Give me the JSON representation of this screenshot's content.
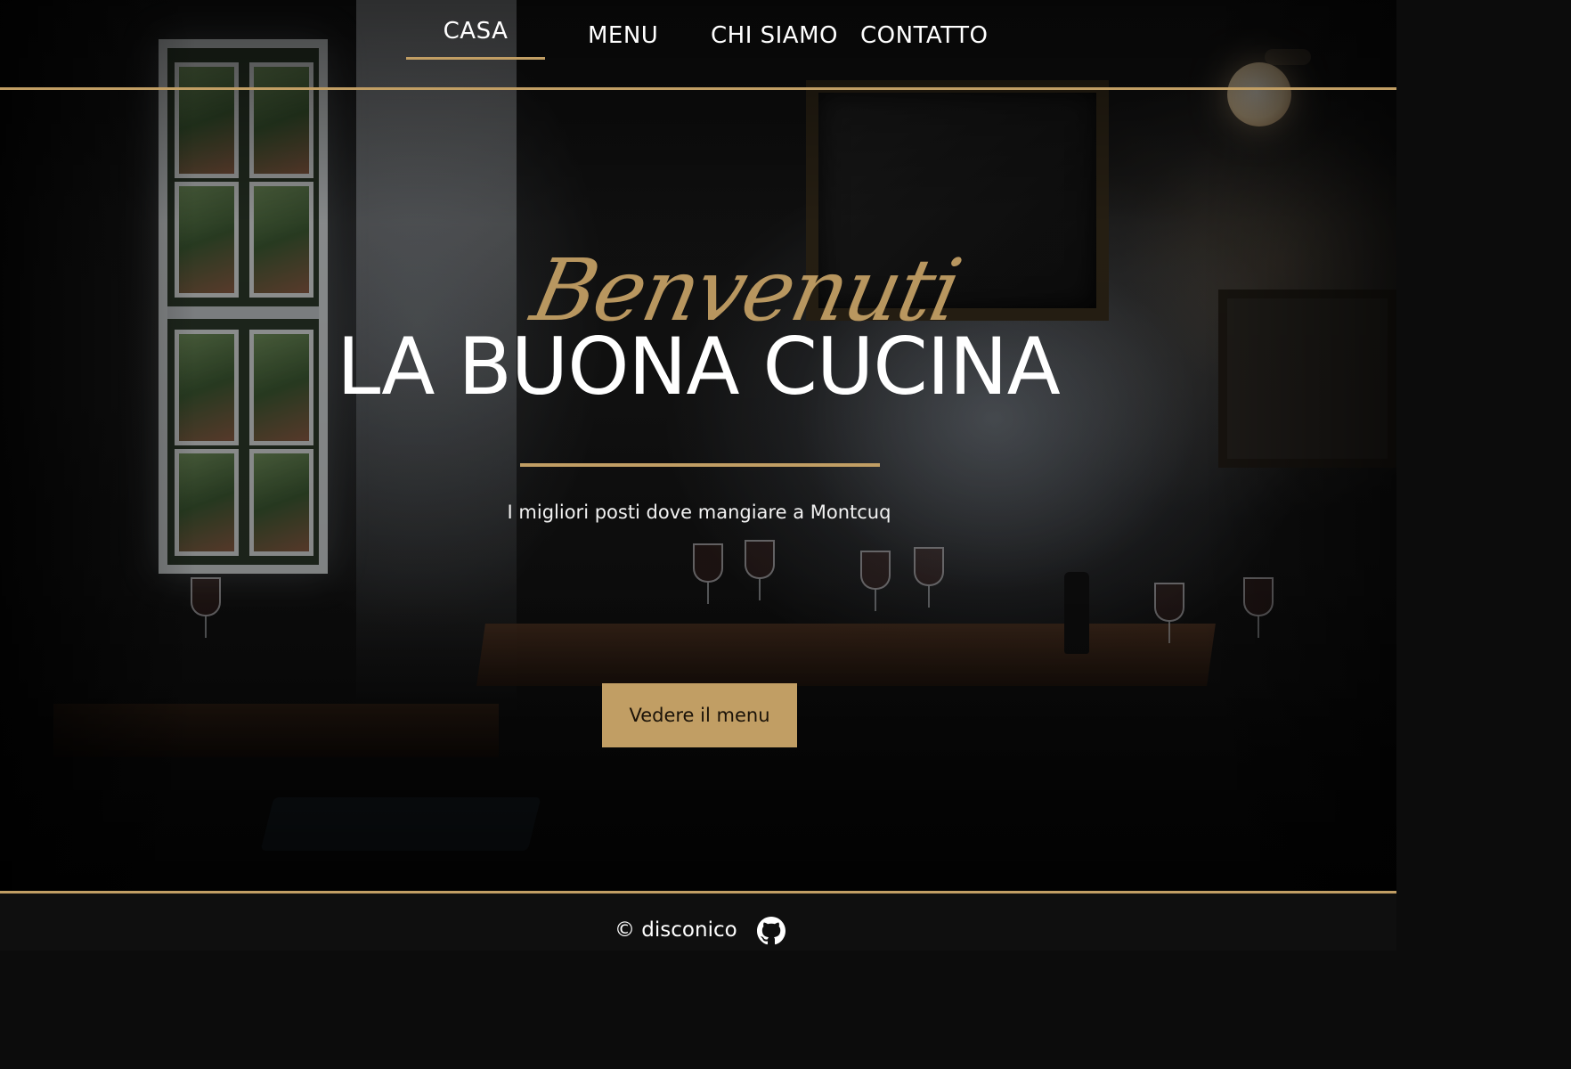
{
  "nav": {
    "items": [
      {
        "label": "CASA",
        "active": true
      },
      {
        "label": "MENU",
        "active": false
      },
      {
        "label": "CHI SIAMO",
        "active": false
      },
      {
        "label": "CONTATTO",
        "active": false
      }
    ]
  },
  "hero": {
    "script_text": "Benvenuti",
    "title": "LA BUONA CUCINA",
    "subtitle": "I migliori posti dove mangiare a Montcuq",
    "cta_label": "Vedere il menu"
  },
  "footer": {
    "copyright": "© disconico",
    "github_icon": "github-icon"
  },
  "colors": {
    "accent_gold": "#c19e64",
    "text_white": "#ffffff",
    "background_dark": "#0f0f0f"
  }
}
